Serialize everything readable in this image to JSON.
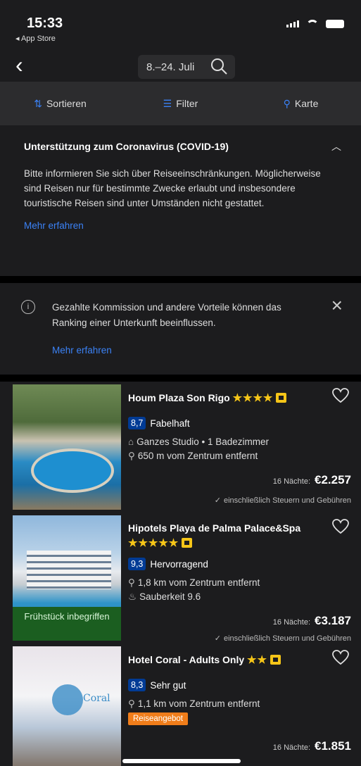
{
  "status": {
    "time": "15:33",
    "back_app": "◂ App Store"
  },
  "nav": {
    "back_icon": "‹",
    "date_range": "8.–24. Juli"
  },
  "toolbar": {
    "sort": "Sortieren",
    "filter": "Filter",
    "map": "Karte"
  },
  "covid": {
    "title": "Unterstützung zum Coronavirus (COVID-19)",
    "text": "Bitte informieren Sie sich über Reiseeinschränkungen. Möglicherweise sind Reisen nur für bestimmte Zwecke erlaubt und insbesondere touristische Reisen sind unter Umständen nicht gestattet.",
    "more": "Mehr erfahren"
  },
  "notice": {
    "text": "Gezahlte Kommission und andere Vorteile können das Ranking einer Unterkunft beeinflussen.",
    "more": "Mehr erfahren"
  },
  "hotels": [
    {
      "name": "Houm Plaza Son Rigo",
      "stars": "★★★★",
      "score": "8,7",
      "score_label": "Fabelhaft",
      "line1": "Ganzes Studio • 1 Badezimmer",
      "line2": "650 m vom Zentrum entfernt",
      "nights": "16 Nächte:",
      "price": "€2.257",
      "tax": "einschließlich Steuern und Gebühren"
    },
    {
      "name": "Hipotels Playa de Palma Palace&Spa",
      "stars": "★★★★★",
      "score": "9,3",
      "score_label": "Hervorragend",
      "line1": "1,8 km vom Zentrum entfernt",
      "line2": "Sauberkeit 9.6",
      "badge": "Frühstück inbegriffen",
      "nights": "16 Nächte:",
      "price": "€3.187",
      "tax": "einschließlich Steuern und Gebühren"
    },
    {
      "name": "Hotel Coral - Adults Only",
      "stars": "★★",
      "score": "8,3",
      "score_label": "Sehr gut",
      "line1": "1,1 km vom Zentrum entfernt",
      "deal": "Reiseangebot",
      "logo": "Coral",
      "nights": "16 Nächte:",
      "price": "€1.851"
    }
  ],
  "colors": {
    "accent": "#3b82f6",
    "score_bg": "#003b95",
    "stars": "#f5c518",
    "deal": "#f07d1a",
    "breakfast": "#1b5e20"
  }
}
